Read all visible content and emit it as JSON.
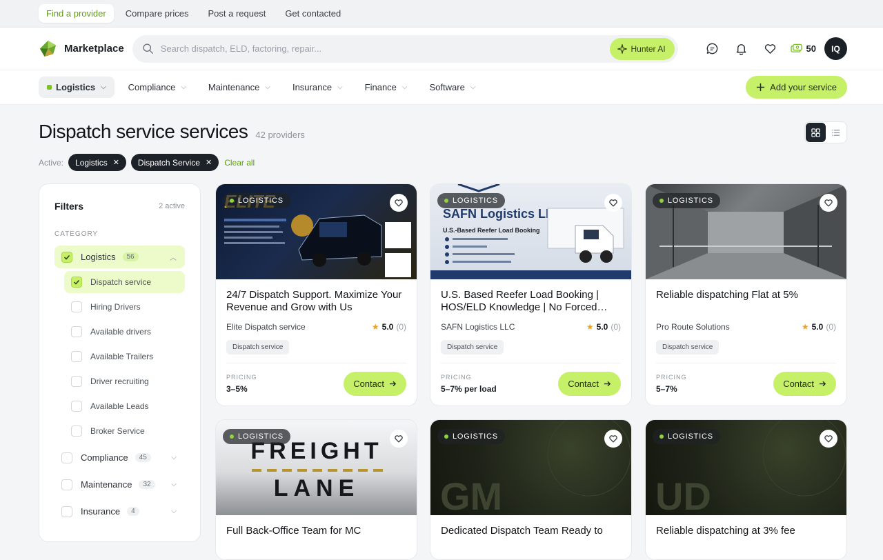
{
  "topstrip": {
    "tabs": [
      "Find a provider",
      "Compare prices",
      "Post a request",
      "Get contacted"
    ]
  },
  "header": {
    "brand": "Marketplace",
    "search_placeholder": "Search dispatch, ELD, factoring, repair...",
    "hunter_label": "Hunter AI",
    "coins": "50",
    "avatar": "IQ"
  },
  "catnav": {
    "items": [
      "Logistics",
      "Compliance",
      "Maintenance",
      "Insurance",
      "Finance",
      "Software"
    ],
    "add_label": "Add your service"
  },
  "page": {
    "title": "Dispatch service services",
    "count": "42 providers"
  },
  "active": {
    "label": "Active:",
    "chips": [
      "Logistics",
      "Dispatch Service"
    ],
    "clear": "Clear all"
  },
  "filters": {
    "title": "Filters",
    "active_count": "2 active",
    "section": "CATEGORY",
    "categories": [
      {
        "label": "Logistics",
        "count": "56"
      },
      {
        "label": "Compliance",
        "count": "45"
      },
      {
        "label": "Maintenance",
        "count": "32"
      },
      {
        "label": "Insurance",
        "count": "4"
      }
    ],
    "sub": [
      "Dispatch service",
      "Hiring Drivers",
      "Available drivers",
      "Available Trailers",
      "Driver recruiting",
      "Available Leads",
      "Broker Service"
    ]
  },
  "cards": [
    {
      "badge": "LOGISTICS",
      "title": "24/7 Dispatch Support. Maximize Your Revenue and Grow with Us",
      "provider": "Elite Dispatch service",
      "rating": "5.0",
      "reviews": "(0)",
      "tag": "Dispatch service",
      "pricing_label": "PRICING",
      "price": "3–5%",
      "cta": "Contact",
      "img_text": "ELITE"
    },
    {
      "badge": "LOGISTICS",
      "title": "U.S. Based Reefer Load Booking | HOS/ELD Knowledge | No Forced…",
      "provider": "SAFN Logistics LLC",
      "rating": "5.0",
      "reviews": "(0)",
      "tag": "Dispatch service",
      "pricing_label": "PRICING",
      "price": "5–7% per load",
      "cta": "Contact",
      "img_text": "SAFN Logistics LLC",
      "img_sub": "U.S.-Based Reefer Load Booking"
    },
    {
      "badge": "LOGISTICS",
      "title": "Reliable dispatching Flat at 5%",
      "provider": "Pro Route Solutions",
      "rating": "5.0",
      "reviews": "(0)",
      "tag": "Dispatch service",
      "pricing_label": "PRICING",
      "price": "5–7%",
      "cta": "Contact"
    },
    {
      "badge": "LOGISTICS",
      "title": "Full Back-Office Team for MC",
      "img_text": "FREIGHT",
      "img_text2": "LANE"
    },
    {
      "badge": "LOGISTICS",
      "title": "Dedicated Dispatch Team Ready to",
      "img_text": "GM"
    },
    {
      "badge": "LOGISTICS",
      "title": "Reliable dispatching at 3% fee",
      "img_text": "UD"
    }
  ]
}
